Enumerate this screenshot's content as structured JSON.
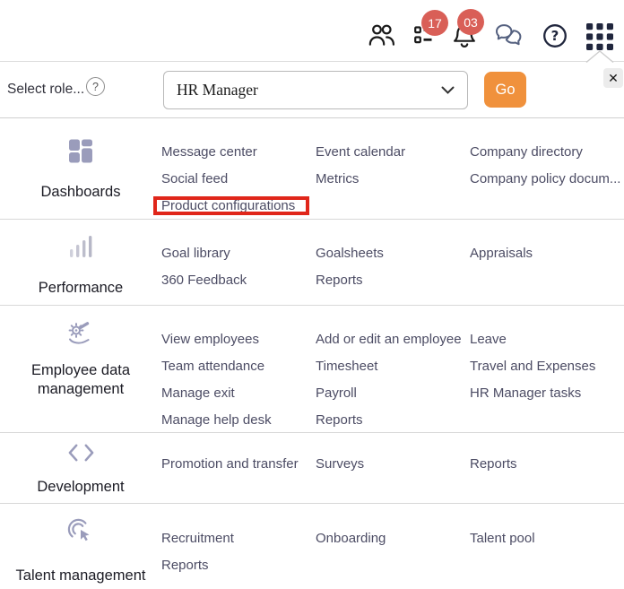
{
  "top_bar": {
    "badges": {
      "tasks_count": "17",
      "notifications_count": "03"
    },
    "icons": [
      "people-icon",
      "tasks-checklist-icon",
      "bell-icon",
      "chat-icon",
      "help-icon",
      "apps-grid-icon"
    ]
  },
  "role_bar": {
    "label": "Select role...",
    "help": "?",
    "selected_role": "HR Manager",
    "go": "Go",
    "close": "✕"
  },
  "sections": [
    {
      "label": "Dashboards",
      "icon": "dashboard-icon",
      "columns": [
        [
          "Message center",
          "Social feed",
          "Product configurations"
        ],
        [
          "Event calendar",
          "Metrics"
        ],
        [
          "Company directory",
          "Company policy docum..."
        ]
      ]
    },
    {
      "label": "Performance",
      "icon": "bar-chart-icon",
      "columns": [
        [
          "Goal library",
          "360 Feedback"
        ],
        [
          "Goalsheets",
          "Reports"
        ],
        [
          "Appraisals"
        ]
      ]
    },
    {
      "label": "Employee data management",
      "icon": "gear-hand-icon",
      "columns": [
        [
          "View employees",
          "Team attendance",
          "Manage exit",
          "Manage help desk"
        ],
        [
          "Add or edit an employee",
          "Timesheet",
          "Payroll",
          "Reports"
        ],
        [
          "Leave",
          "Travel and Expenses",
          "HR Manager tasks"
        ]
      ]
    },
    {
      "label": "Development",
      "icon": "code-brackets-icon",
      "columns": [
        [
          "Promotion and transfer"
        ],
        [
          "Surveys"
        ],
        [
          "Reports"
        ]
      ]
    },
    {
      "label": "Talent management",
      "icon": "target-click-icon",
      "columns": [
        [
          "Recruitment",
          "Reports"
        ],
        [
          "Onboarding"
        ],
        [
          "Talent pool"
        ]
      ]
    }
  ],
  "highlight": {
    "target": "Product configurations",
    "color": "#e0261a"
  },
  "colors": {
    "accent_orange": "#f0913c",
    "badge_red": "#d95f57",
    "link_text": "#4c4c64",
    "section_icon": "#9a9cbb",
    "topbar_icon": "#20263d"
  }
}
